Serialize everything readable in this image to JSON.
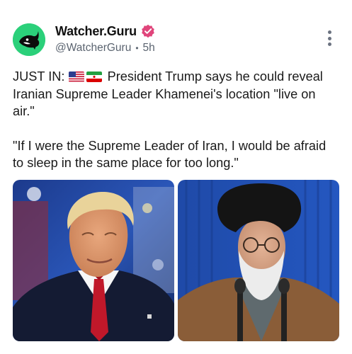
{
  "post": {
    "author": {
      "display_name": "Watcher.Guru",
      "handle": "@WatcherGuru",
      "separator": "•",
      "time": "5h",
      "verified": true,
      "avatar_icon": "orca-logo",
      "avatar_color": "#2bd07a",
      "badge_color": "#e0457b"
    },
    "text": {
      "prefix": "JUST IN:",
      "flags": [
        "us-flag",
        "iran-flag"
      ],
      "headline": "President Trump says he could reveal Iranian Supreme Leader Khamenei's location \"live on air.\"",
      "quote": "\"If I were the Supreme Leader of Iran, I would be afraid to sleep in the same place for too long.\""
    },
    "media": [
      {
        "subject": "president-trump-photo"
      },
      {
        "subject": "khamenei-photo"
      }
    ],
    "menu_icon": "more-vertical-icon"
  }
}
